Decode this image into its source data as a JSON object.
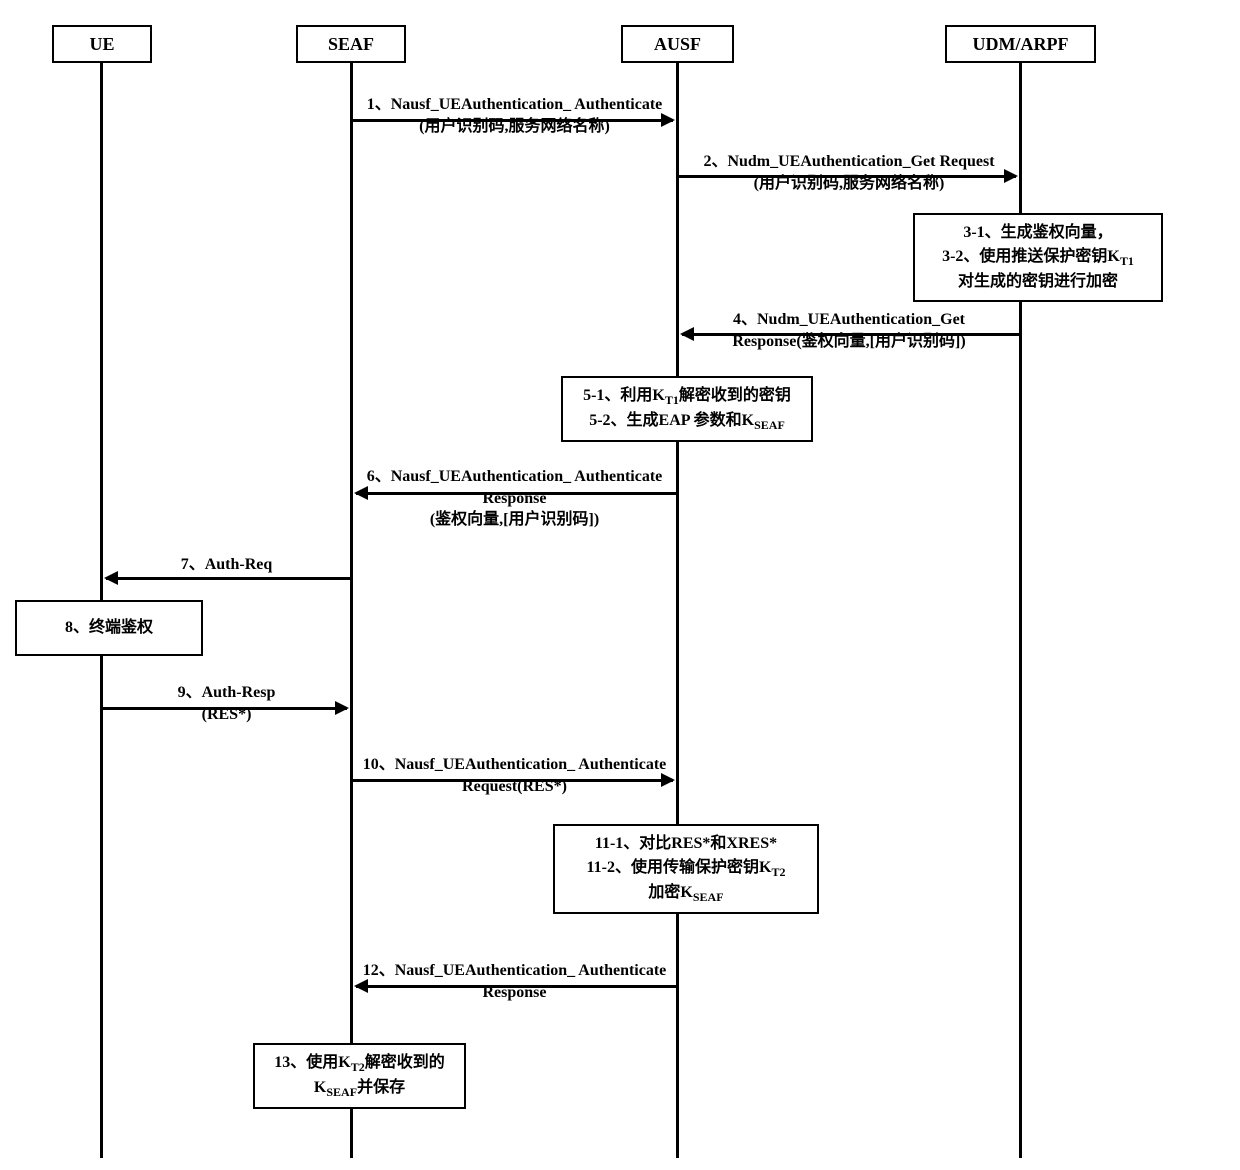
{
  "actors": {
    "ue": "UE",
    "seaf": "SEAF",
    "ausf": "AUSF",
    "udm": "UDM/ARPF"
  },
  "messages": {
    "m1a": "1、Nausf_UEAuthentication_ Authenticate",
    "m1b": "(用户识别码,服务网络名称)",
    "m2a": "2、Nudm_UEAuthentication_Get Request",
    "m2b": "(用户识别码,服务网络名称)",
    "m4a": "4、Nudm_UEAuthentication_Get",
    "m4b": "Response(鉴权向量,[用户识别码])",
    "m6a": "6、Nausf_UEAuthentication_ Authenticate",
    "m6b": "Response",
    "m6c": "(鉴权向量,[用户识别码])",
    "m7": "7、Auth-Req",
    "m9a": "9、Auth-Resp",
    "m9b": "(RES*)",
    "m10a": "10、Nausf_UEAuthentication_ Authenticate",
    "m10b": "Request(RES*)",
    "m12a": "12、Nausf_UEAuthentication_ Authenticate",
    "m12b": "Response"
  },
  "boxes": {
    "b3a": "3-1、生成鉴权向量，",
    "b3b_pre": "3-2、使用推送保护密钥K",
    "b3b_sub": "T1",
    "b3c": "对生成的密钥进行加密",
    "b5a_pre": "5-1、利用K",
    "b5a_sub": "T1",
    "b5a_post": "解密收到的密钥",
    "b5b_pre": "5-2、生成EAP 参数和K",
    "b5b_sub": "SEAF",
    "b8": "8、终端鉴权",
    "b11a": "11-1、对比RES*和XRES*",
    "b11b_pre": "11-2、使用传输保护密钥K",
    "b11b_sub": "T2",
    "b11c_pre": "加密K",
    "b11c_sub": "SEAF",
    "b13a_pre": "13、使用K",
    "b13a_sub": "T2",
    "b13a_post": "解密收到的",
    "b13b_pre": "K",
    "b13b_sub": "SEAF",
    "b13b_post": "并保存"
  }
}
